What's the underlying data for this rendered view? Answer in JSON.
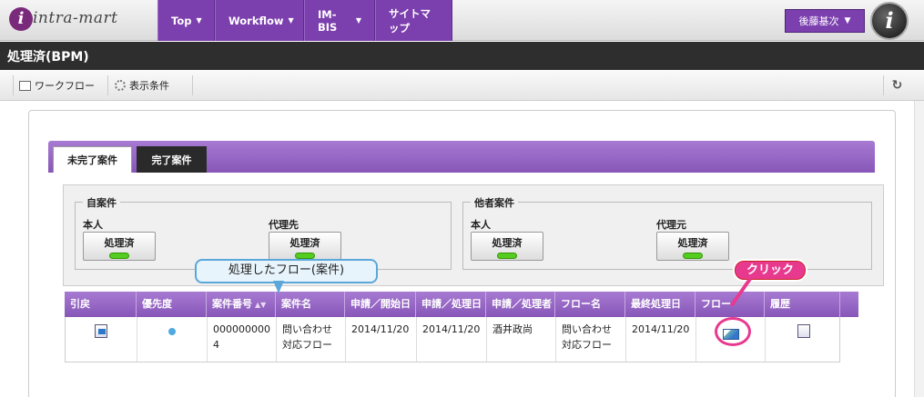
{
  "header": {
    "logo_text": "intra-mart",
    "logo_mark": "i",
    "nav": [
      {
        "label": "Top"
      },
      {
        "label": "Workflow"
      },
      {
        "label": "IM-BIS"
      },
      {
        "label": "サイトマップ"
      }
    ],
    "user_name": "後藤基次",
    "avatar_mark": "i"
  },
  "title": "処理済(BPM)",
  "toolbar": {
    "workflow_label": "ワークフロー",
    "display_condition_label": "表示条件",
    "refresh_icon": "↻"
  },
  "tabs": [
    {
      "label": "未完了案件",
      "active": true
    },
    {
      "label": "完了案件",
      "active": false
    }
  ],
  "filters": {
    "own": {
      "legend": "自案件",
      "groups": [
        {
          "label": "本人",
          "button": "処理済"
        },
        {
          "label": "代理先",
          "button": "処理済"
        }
      ]
    },
    "others": {
      "legend": "他者案件",
      "groups": [
        {
          "label": "本人",
          "button": "処理済"
        },
        {
          "label": "代理元",
          "button": "処理済"
        }
      ]
    }
  },
  "table": {
    "headers": [
      "引戻",
      "優先度",
      "案件番号",
      "案件名",
      "申請／開始日",
      "申請／処理日",
      "申請／処理者",
      "フロー名",
      "最終処理日",
      "フロー",
      "履歴"
    ],
    "rows": [
      {
        "case_number": "0000000004",
        "case_name": "問い合わせ対応フロー",
        "start_date": "2014/11/20",
        "process_date": "2014/11/20",
        "processor": "酒井政尚",
        "flow_name": "問い合わせ対応フロー",
        "last_process_date": "2014/11/20"
      }
    ]
  },
  "callouts": {
    "processed_flow": "処理したフロー(案件)",
    "click": "クリック"
  }
}
